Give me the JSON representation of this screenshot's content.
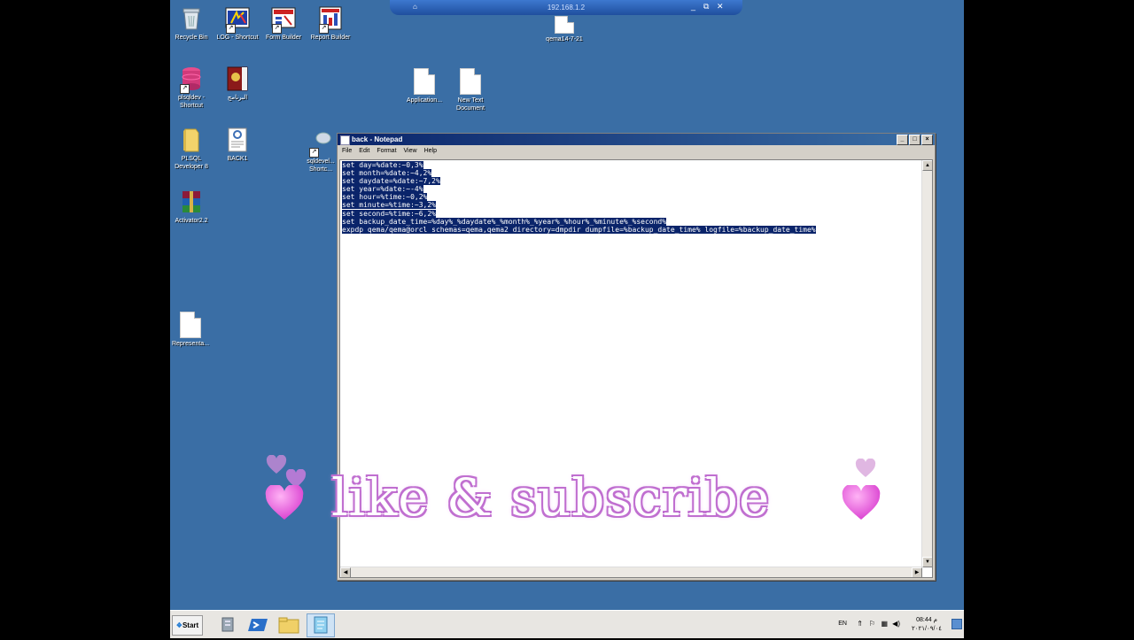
{
  "rdp_bar": {
    "title": "192.168.1.2",
    "pin": "⌂",
    "min": "_",
    "restore": "⧉",
    "close": "✕"
  },
  "desktop_icons": [
    {
      "label": "Recycle Bin"
    },
    {
      "label": "LOG - Shortcut"
    },
    {
      "label": "Form Builder"
    },
    {
      "label": "Report Builder"
    },
    {
      "label": "qema14-7-21"
    },
    {
      "label": "plsqldev - Shortcut"
    },
    {
      "label": "البرنامج"
    },
    {
      "label": "Application..."
    },
    {
      "label": "New Text Document"
    },
    {
      "label": "PLSQL Developer 8"
    },
    {
      "label": "BACK1"
    },
    {
      "label": "sqldevel... Shortc..."
    },
    {
      "label": "Activator2.2"
    },
    {
      "label": "Representa..."
    }
  ],
  "notepad": {
    "title": "back - Notepad",
    "menu": [
      "File",
      "Edit",
      "Format",
      "View",
      "Help"
    ],
    "lines": [
      "set day=%date:~0,3%",
      "set month=%date:~4,2%",
      "set daydate=%date:~7,2%",
      "set year=%date:~-4%",
      "set hour=%time:~0,2%",
      "set minute=%time:~3,2%",
      "set second=%time:~6,2%",
      "set backup_date_time=%day%_%daydate%_%month%_%year%_%hour%_%minute%_%second%",
      "expdp qema/qema@orcl schemas=qema,qema2 directory=dmpdir dumpfile=%backup_date_time% logfile=%backup_date_time%"
    ]
  },
  "overlay": {
    "text": "like & subscribe"
  },
  "taskbar": {
    "start_label": "Start",
    "language": "EN",
    "time": "08:44 م",
    "date": "٢٠٢١/٠٩/٠٤"
  },
  "colors": {
    "desktop": "#3a6ea5",
    "titlebar": "#0a246a",
    "heart": "#e14fd6",
    "overlay_outline": "#c06fd0"
  }
}
